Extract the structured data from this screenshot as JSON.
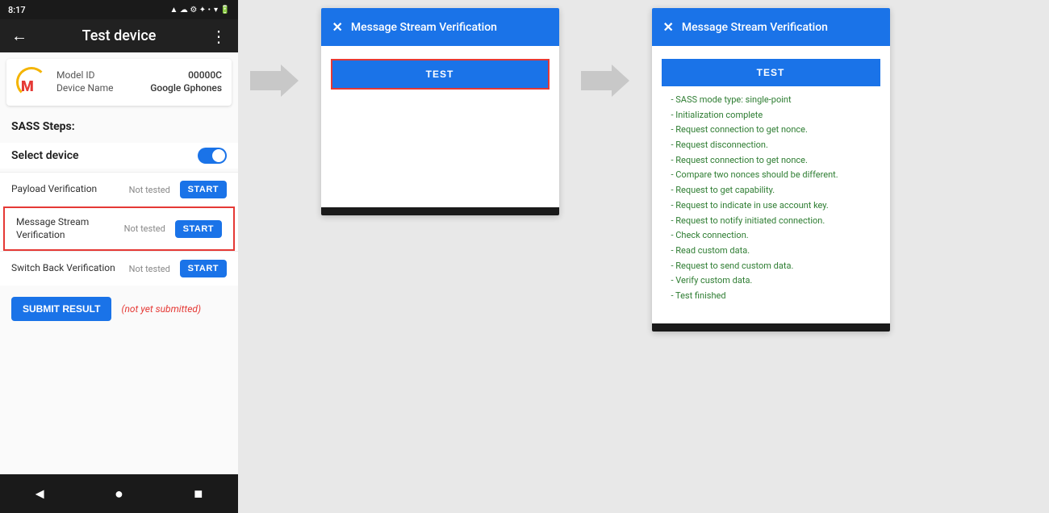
{
  "statusBar": {
    "time": "8:17",
    "icons": "▲ ☁ ⚙ ✦ •",
    "rightIcons": "▾ 🔋"
  },
  "navBar": {
    "backIcon": "←",
    "title": "Test device",
    "menuIcon": "⋮"
  },
  "deviceInfo": {
    "modelIdLabel": "Model ID",
    "modelIdValue": "00000C",
    "deviceNameLabel": "Device Name",
    "deviceNameValue": "Google Gphones"
  },
  "sassSteps": {
    "title": "SASS Steps:",
    "selectDeviceLabel": "Select device",
    "steps": [
      {
        "name": "Payload Verification",
        "status": "Not tested",
        "startLabel": "START",
        "highlighted": false
      },
      {
        "name": "Message Stream\nVerification",
        "status": "Not tested",
        "startLabel": "START",
        "highlighted": true
      },
      {
        "name": "Switch Back Verification",
        "status": "Not tested",
        "startLabel": "START",
        "highlighted": false
      }
    ],
    "submitLabel": "SUBMIT RESULT",
    "notSubmittedText": "(not yet submitted)"
  },
  "bottomBar": {
    "backBtn": "◄",
    "homeBtn": "●",
    "recentBtn": "■"
  },
  "dialog1": {
    "closeIcon": "✕",
    "title": "Message Stream Verification",
    "testButtonLabel": "TEST"
  },
  "dialog2": {
    "closeIcon": "✕",
    "title": "Message Stream Verification",
    "testButtonLabel": "TEST",
    "results": [
      "- SASS mode type: single-point",
      "- Initialization complete",
      "- Request connection to get nonce.",
      "- Request disconnection.",
      "- Request connection to get nonce.",
      "- Compare two nonces should be different.",
      "- Request to get capability.",
      "- Request to indicate in use account key.",
      "- Request to notify initiated connection.",
      "- Check connection.",
      "- Read custom data.",
      "- Request to send custom data.",
      "- Verify custom data.",
      "- Test finished"
    ]
  }
}
